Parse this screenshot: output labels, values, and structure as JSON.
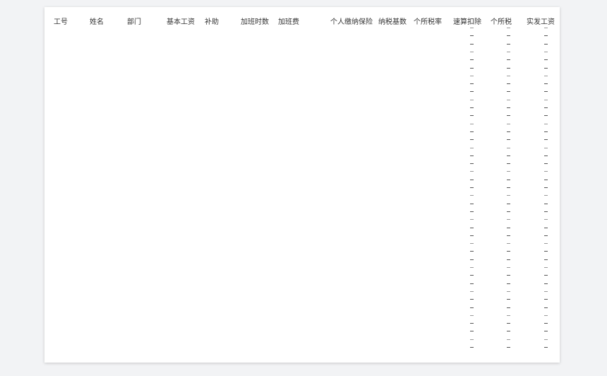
{
  "table": {
    "headers": [
      {
        "key": "emp_id",
        "label": "工号"
      },
      {
        "key": "name",
        "label": "姓名"
      },
      {
        "key": "dept",
        "label": "部门"
      },
      {
        "key": "base_salary",
        "label": "基本工资"
      },
      {
        "key": "allowance",
        "label": "补助"
      },
      {
        "key": "ot_hours",
        "label": "加班时数"
      },
      {
        "key": "ot_pay",
        "label": "加班费"
      },
      {
        "key": "insurance",
        "label": "个人缴纳保险"
      },
      {
        "key": "taxable_base",
        "label": "纳税基数"
      },
      {
        "key": "tax_rate",
        "label": "个所税率"
      },
      {
        "key": "quick_deduction",
        "label": "速算扣除"
      },
      {
        "key": "income_tax",
        "label": "个所税"
      },
      {
        "key": "net_pay",
        "label": "实发工资"
      }
    ],
    "empty_value": "–",
    "row_count": 41
  }
}
